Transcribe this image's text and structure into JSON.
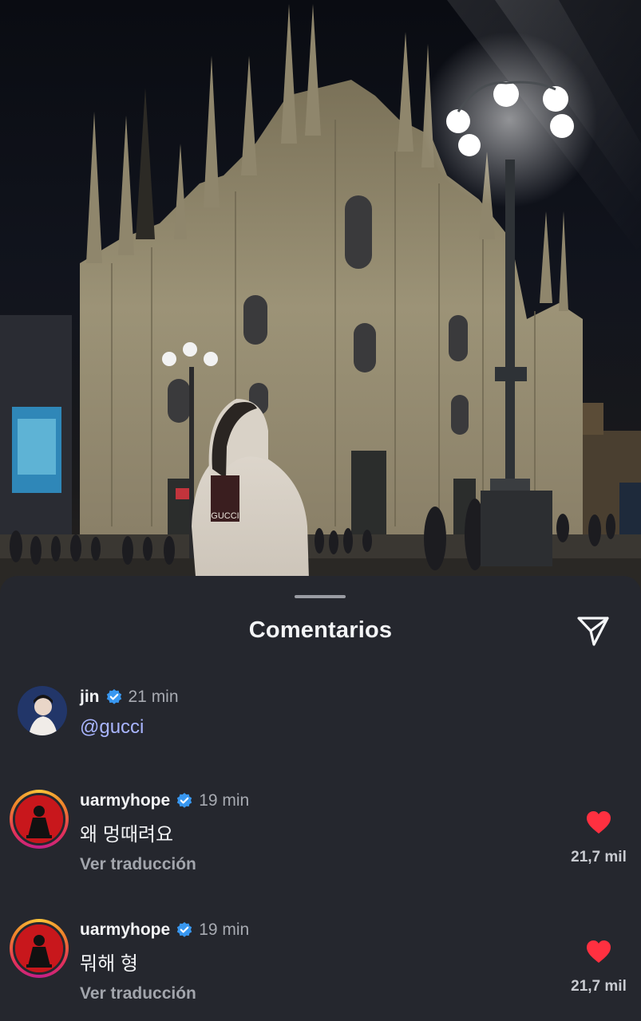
{
  "sheet": {
    "title": "Comentarios"
  },
  "comments": [
    {
      "username": "jin",
      "time": "21 min",
      "text": "@gucci",
      "verified": true
    },
    {
      "username": "uarmyhope",
      "time": "19 min",
      "text": "왜 멍때려요",
      "translate_label": "Ver traducción",
      "likes": "21,7 mil",
      "verified": true
    },
    {
      "username": "uarmyhope",
      "time": "19 min",
      "text": "뭐해 형",
      "translate_label": "Ver traducción",
      "likes": "21,7 mil",
      "verified": true
    }
  ],
  "colors": {
    "sheet_bg": "#25272e",
    "verified_blue": "#3897f0",
    "like_red": "#ff3040",
    "mention": "#a9b5ff"
  },
  "icons": [
    "share-paper-plane-icon",
    "verified-badge-icon",
    "heart-filled-icon"
  ]
}
